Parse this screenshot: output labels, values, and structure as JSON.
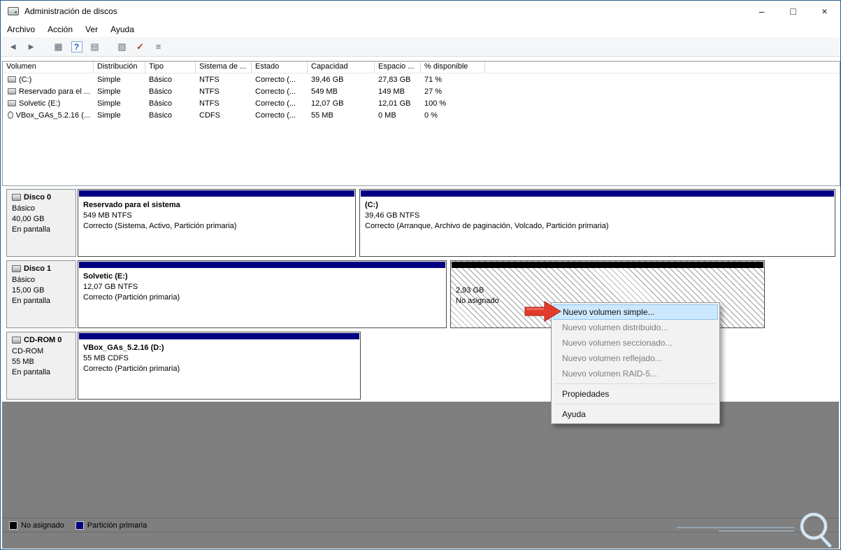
{
  "window": {
    "title": "Administración de discos",
    "controls": {
      "minimize": "–",
      "maximize": "□",
      "close": "×"
    }
  },
  "menu": {
    "items": [
      "Archivo",
      "Acción",
      "Ver",
      "Ayuda"
    ]
  },
  "toolbar": {
    "icons": [
      {
        "name": "back-icon",
        "glyph": "◄"
      },
      {
        "name": "forward-icon",
        "glyph": "►"
      },
      {
        "name": "console-tree-icon",
        "glyph": "▦"
      },
      {
        "name": "help-icon",
        "glyph": "?"
      },
      {
        "name": "export-list-icon",
        "glyph": "▤"
      },
      {
        "name": "action-pane-icon",
        "glyph": "▧"
      },
      {
        "name": "check-disk-icon",
        "glyph": "✓"
      },
      {
        "name": "details-view-icon",
        "glyph": "≡"
      }
    ]
  },
  "volume_table": {
    "columns": [
      "Volumen",
      "Distribución",
      "Tipo",
      "Sistema de ...",
      "Estado",
      "Capacidad",
      "Espacio ...",
      "% disponible"
    ],
    "rows": [
      {
        "icon": "drive-icon",
        "cells": [
          "(C:)",
          "Simple",
          "Básico",
          "NTFS",
          "Correcto (...",
          "39,46 GB",
          "27,83 GB",
          "71 %"
        ]
      },
      {
        "icon": "drive-icon",
        "cells": [
          "Reservado para el ...",
          "Simple",
          "Básico",
          "NTFS",
          "Correcto (...",
          "549 MB",
          "149 MB",
          "27 %"
        ]
      },
      {
        "icon": "drive-icon",
        "cells": [
          "Solvetic (E:)",
          "Simple",
          "Básico",
          "NTFS",
          "Correcto (...",
          "12,07 GB",
          "12,01 GB",
          "100 %"
        ]
      },
      {
        "icon": "cd-icon",
        "cells": [
          "VBox_GAs_5.2.16 (...",
          "Simple",
          "Básico",
          "CDFS",
          "Correcto (...",
          "55 MB",
          "0 MB",
          "0 %"
        ]
      }
    ]
  },
  "disks": [
    {
      "name": "Disco 0",
      "kind": "Básico",
      "size": "40,00 GB",
      "status": "En pantalla",
      "partitions": [
        {
          "name": "Reservado para el sistema",
          "size": "549 MB NTFS",
          "status": "Correcto (Sistema, Activo, Partición primaria)",
          "type": "primary"
        },
        {
          "name": "(C:)",
          "size": "39,46 GB NTFS",
          "status": "Correcto (Arranque, Archivo de paginación, Volcado, Partición primaria)",
          "type": "primary"
        }
      ]
    },
    {
      "name": "Disco 1",
      "kind": "Básico",
      "size": "15,00 GB",
      "status": "En pantalla",
      "partitions": [
        {
          "name": "Solvetic  (E:)",
          "size": "12,07 GB NTFS",
          "status": "Correcto (Partición primaria)",
          "type": "primary"
        },
        {
          "name": "",
          "size": "2,93 GB",
          "status": "No asignado",
          "type": "unallocated"
        }
      ]
    },
    {
      "name": "CD-ROM 0",
      "kind": "CD-ROM",
      "size": "55 MB",
      "status": "En pantalla",
      "partitions": [
        {
          "name": "VBox_GAs_5.2.16 (D:)",
          "size": "55 MB CDFS",
          "status": "Correcto (Partición primaria)",
          "type": "primary"
        }
      ]
    }
  ],
  "context_menu": {
    "items": [
      {
        "label": "Nuevo volumen simple...",
        "state": "highlighted"
      },
      {
        "label": "Nuevo volumen distribuido...",
        "state": "disabled"
      },
      {
        "label": "Nuevo volumen seccionado...",
        "state": "disabled"
      },
      {
        "label": "Nuevo volumen reflejado...",
        "state": "disabled"
      },
      {
        "label": "Nuevo volumen RAID-5...",
        "state": "disabled"
      },
      {
        "label": "Propiedades",
        "state": "normal"
      },
      {
        "label": "Ayuda",
        "state": "normal"
      }
    ]
  },
  "legend": {
    "items": [
      {
        "label": "No asignado",
        "color": "#000000"
      },
      {
        "label": "Partición primaria",
        "color": "#000080"
      }
    ]
  },
  "colors": {
    "primary_partition": "#000080",
    "unallocated": "#000000",
    "menu_highlight": "#cce8ff",
    "arrow_red": "#e23b2a",
    "pane_gray": "#7f7f7f"
  }
}
